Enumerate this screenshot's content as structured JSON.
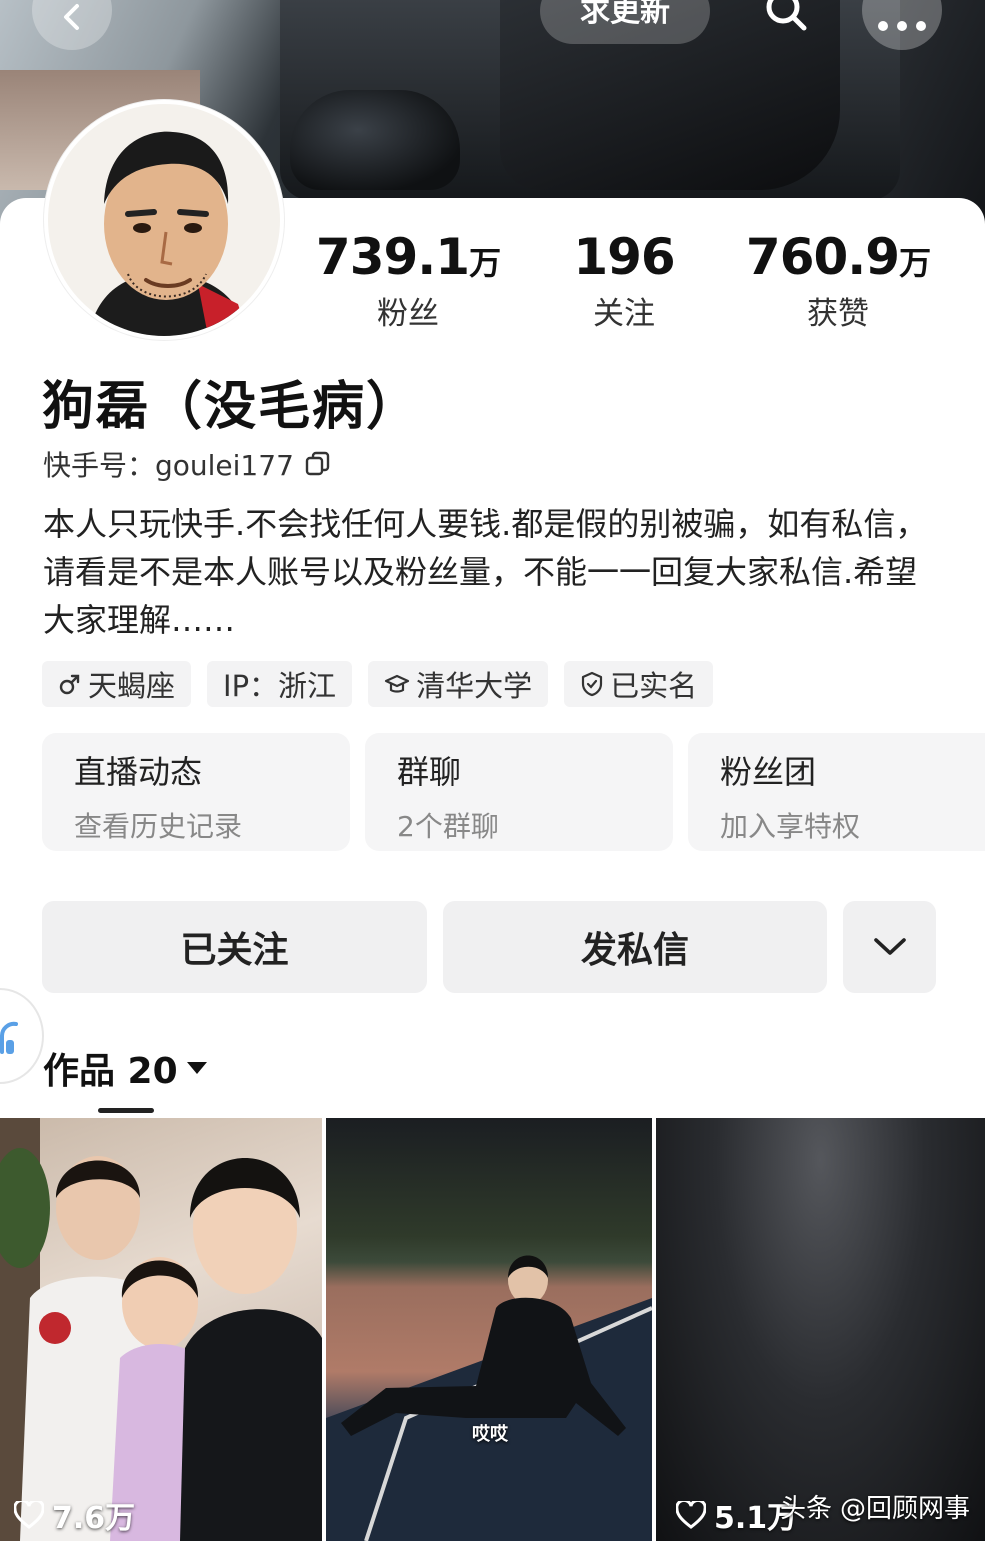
{
  "header": {
    "update_label": "求更新"
  },
  "profile": {
    "name": "狗磊（没毛病）",
    "user_id": "快手号：goulei177",
    "bio": "本人只玩快手.不会找任何人要钱.都是假的别被骗，如有私信，请看是不是本人账号以及粉丝量，不能一一回复大家私信.希望大家理解……"
  },
  "stats": [
    {
      "value": "739.1",
      "unit": "万",
      "label": "粉丝"
    },
    {
      "value": "196",
      "unit": "",
      "label": "关注"
    },
    {
      "value": "760.9",
      "unit": "万",
      "label": "获赞"
    }
  ],
  "tags": [
    {
      "icon": "male-icon",
      "label": "天蝎座"
    },
    {
      "icon": "",
      "label": "IP：浙江"
    },
    {
      "icon": "graduation-cap-icon",
      "label": "清华大学"
    },
    {
      "icon": "shield-check-icon",
      "label": "已实名"
    }
  ],
  "features": [
    {
      "title": "直播动态",
      "sub": "查看历史记录"
    },
    {
      "title": "群聊",
      "sub": "2个群聊"
    },
    {
      "title": "粉丝团",
      "sub": "加入享特权"
    }
  ],
  "actions": {
    "follow_label": "已关注",
    "message_label": "发私信"
  },
  "works": {
    "tab_label": "作品 20"
  },
  "videos": [
    {
      "likes": "7.6万",
      "caption": ""
    },
    {
      "likes": "",
      "caption": "哎哎"
    },
    {
      "likes": "5.1万",
      "caption": ""
    }
  ],
  "watermark": {
    "brand": "头条",
    "account": "@回顾网事"
  },
  "colors": {
    "card_bg": "#ffffff",
    "chip_bg": "#f3f3f4",
    "button_bg": "#f0f0f1",
    "text_primary": "#111111",
    "text_secondary": "#888888"
  }
}
